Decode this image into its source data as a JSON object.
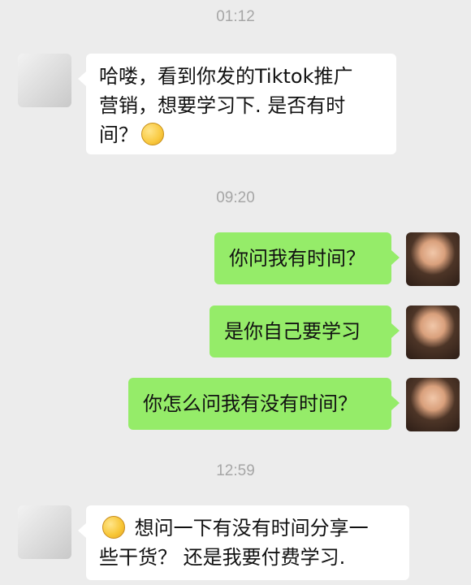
{
  "timestamps": [
    "01:12",
    "09:20",
    "12:59"
  ],
  "messages": [
    {
      "side": "received",
      "text": "哈喽，看到你发的Tiktok推广\n营销，想要学习下. 是否有时\n间？",
      "emoji": "grinning-face-icon"
    },
    {
      "side": "sent",
      "text": "你问我有时间？"
    },
    {
      "side": "sent",
      "text": "是你自己要学习"
    },
    {
      "side": "sent",
      "text": "你怎么问我有没有时间？"
    },
    {
      "side": "received",
      "emoji": "tears-of-joy-icon",
      "text": " 想问一下有没有时间分享一\n些干货？ 还是我要付费学习."
    }
  ],
  "colors": {
    "background": "#ececec",
    "received_bubble": "#ffffff",
    "sent_bubble": "#95ec69",
    "timestamp": "#a6a6a6",
    "text": "#111111"
  }
}
